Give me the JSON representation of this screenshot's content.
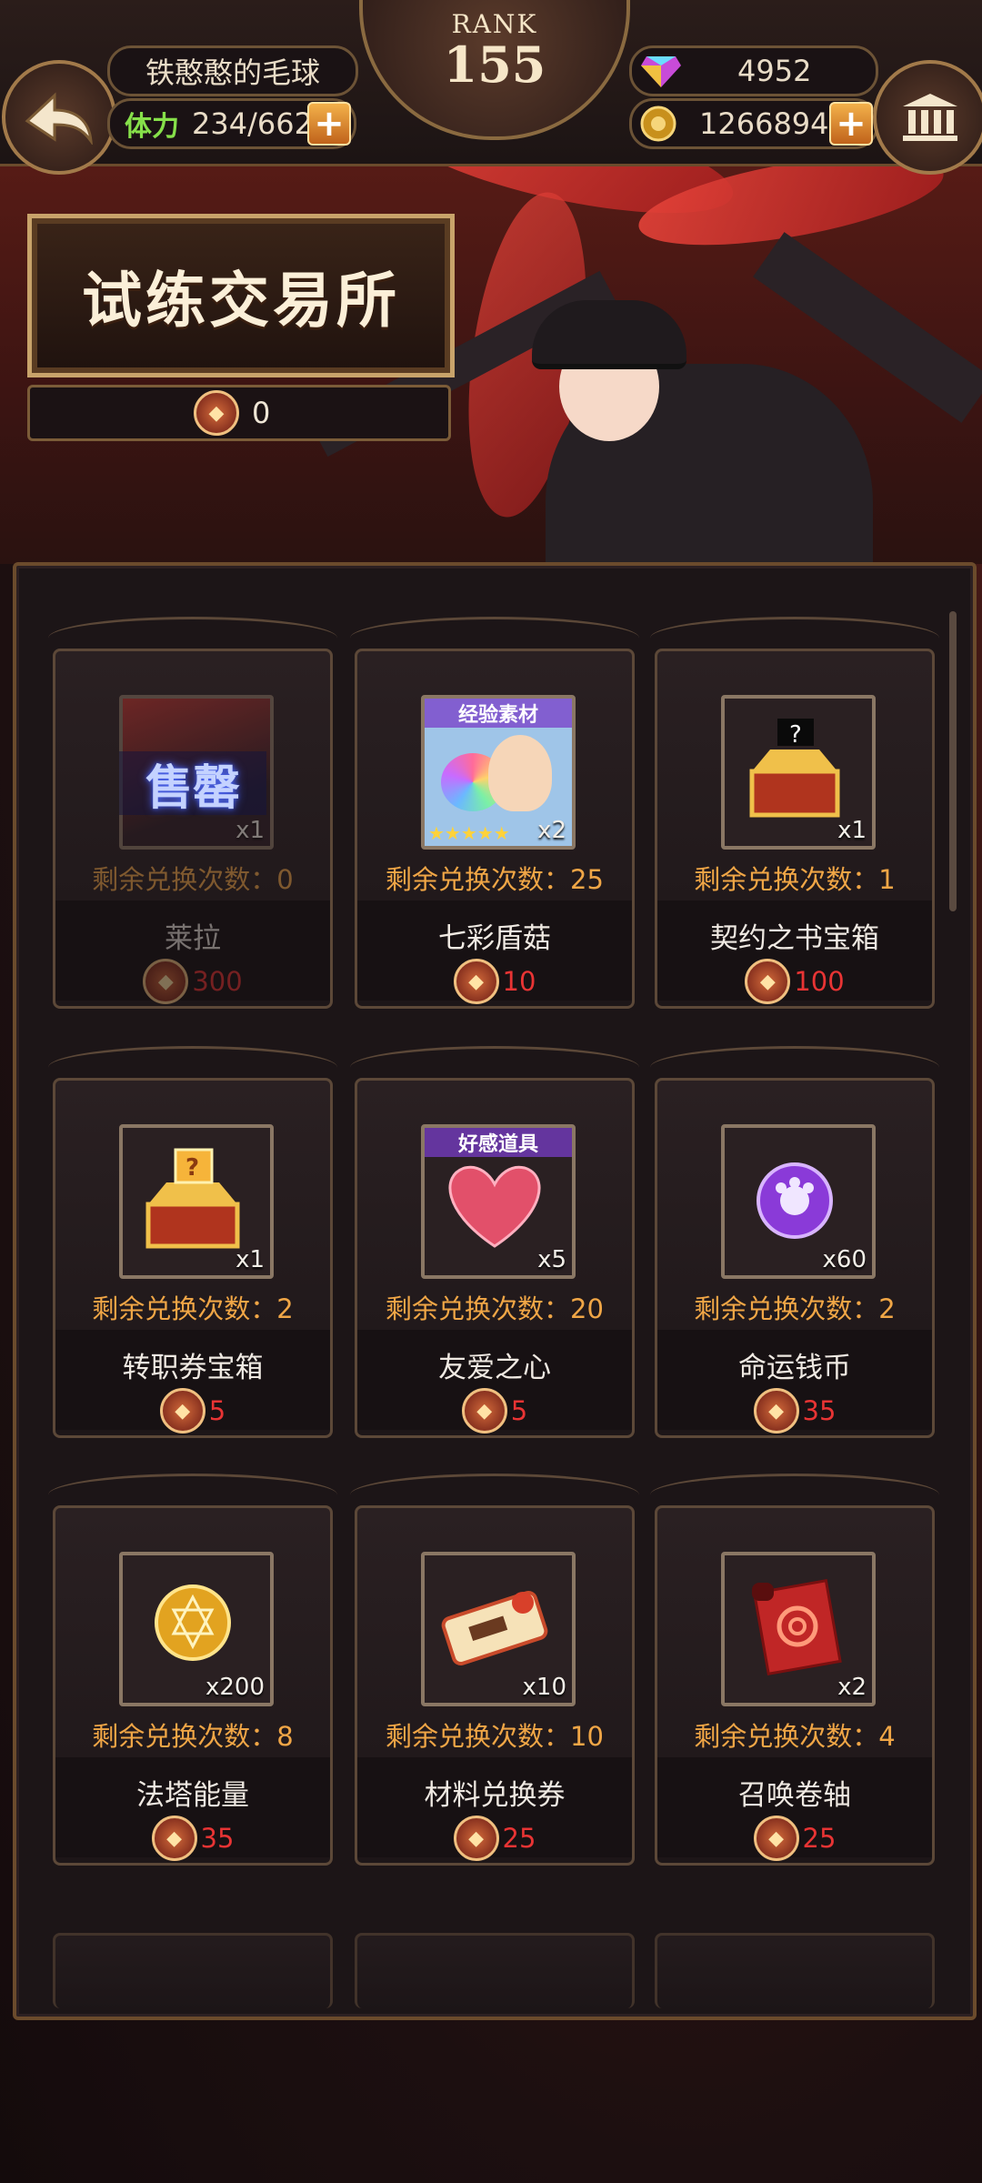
{
  "header": {
    "player_name": "铁憨憨的毛球",
    "stamina_label": "体力",
    "stamina_value": "234/662",
    "rank_label": "RANK",
    "rank_value": "155",
    "gems": "4952",
    "gold": "1266894",
    "plus_symbol": "+"
  },
  "shop": {
    "title": "试练交易所",
    "token_count": "0"
  },
  "items": [
    {
      "name": "莱拉",
      "remaining": "剩余兑换次数：0",
      "price": "300",
      "qty": "x1",
      "icon": "character-card",
      "sold": true,
      "sold_label": "售罄"
    },
    {
      "name": "七彩盾菇",
      "remaining": "剩余兑换次数：25",
      "price": "10",
      "qty": "x2",
      "icon": "rainbow-mushroom",
      "badge": "经验素材",
      "stars": "★★★★★",
      "sold": false
    },
    {
      "name": "契约之书宝箱",
      "remaining": "剩余兑换次数：1",
      "price": "100",
      "qty": "x1",
      "icon": "mystery-chest-black",
      "sold": false
    },
    {
      "name": "转职券宝箱",
      "remaining": "剩余兑换次数：2",
      "price": "5",
      "qty": "x1",
      "icon": "mystery-chest-gold",
      "sold": false
    },
    {
      "name": "友爱之心",
      "remaining": "剩余兑换次数：20",
      "price": "5",
      "qty": "x5",
      "icon": "heart",
      "badge": "好感道具",
      "sold": false
    },
    {
      "name": "命运钱币",
      "remaining": "剩余兑换次数：2",
      "price": "35",
      "qty": "x60",
      "icon": "purple-coin",
      "sold": false
    },
    {
      "name": "法塔能量",
      "remaining": "剩余兑换次数：8",
      "price": "35",
      "qty": "x200",
      "icon": "gold-orb",
      "sold": false
    },
    {
      "name": "材料兑换券",
      "remaining": "剩余兑换次数：10",
      "price": "25",
      "qty": "x10",
      "icon": "ticket",
      "sold": false
    },
    {
      "name": "召唤卷轴",
      "remaining": "剩余兑换次数：4",
      "price": "25",
      "qty": "x2",
      "icon": "red-scroll",
      "sold": false
    }
  ],
  "colors": {
    "remaining_text": "#f0a646",
    "price_text": "#e83434",
    "frame_gold": "#c8a36a"
  }
}
